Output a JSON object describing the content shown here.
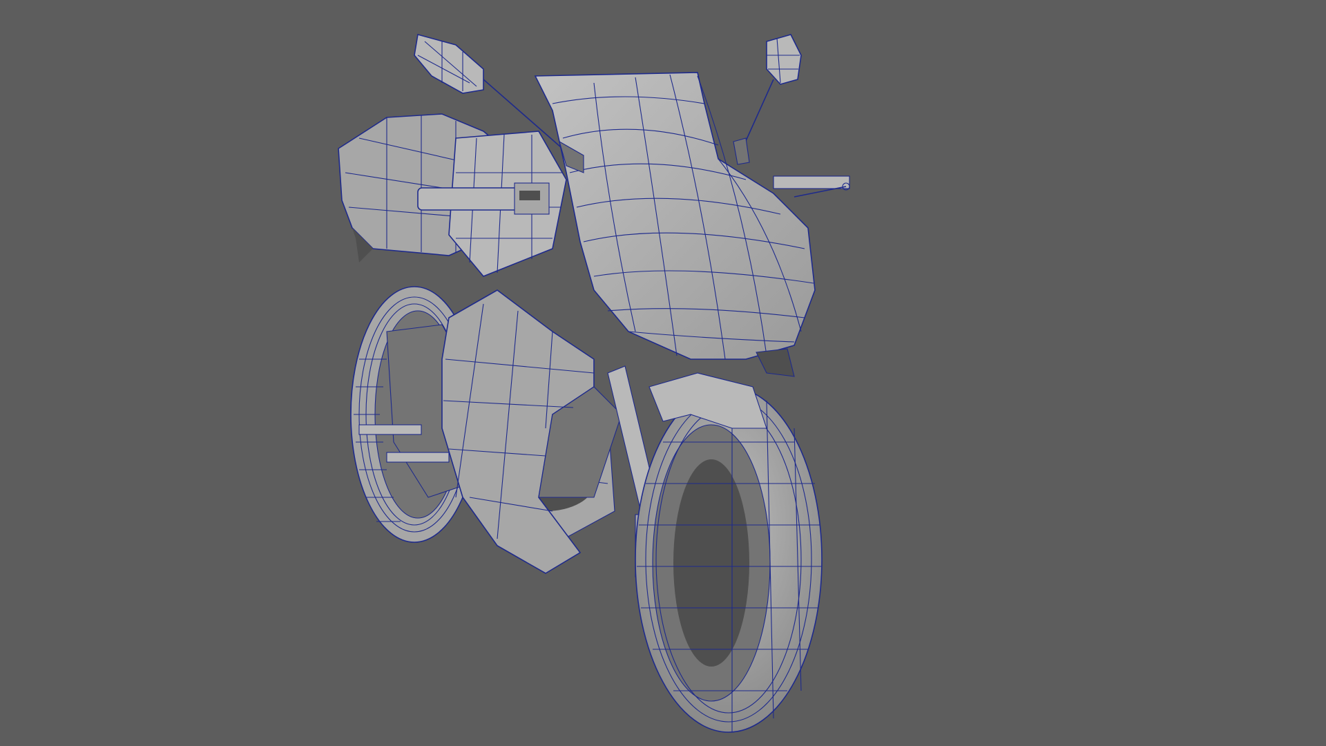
{
  "viewport": {
    "background_color": "#5d5d5d",
    "model": {
      "description_icon": "motorcycle-wireframe-model",
      "shaded_color": "#a7a7a7",
      "wireframe_color": "#1e2a8c",
      "display_mode": "wireframe-on-shaded"
    }
  }
}
